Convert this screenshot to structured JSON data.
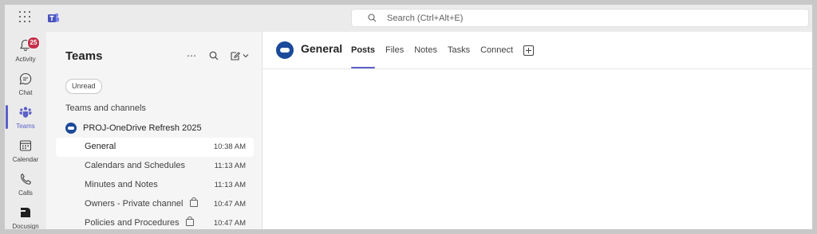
{
  "search": {
    "placeholder": "Search (Ctrl+Alt+E)"
  },
  "rail": {
    "items": [
      {
        "label": "Activity",
        "badge": "25",
        "icon": "bell-icon"
      },
      {
        "label": "Chat",
        "icon": "chat-icon"
      },
      {
        "label": "Teams",
        "icon": "teams-icon",
        "active": true
      },
      {
        "label": "Calendar",
        "icon": "calendar-icon"
      },
      {
        "label": "Calls",
        "icon": "phone-icon"
      },
      {
        "label": "Docusign",
        "icon": "docusign-icon"
      }
    ]
  },
  "panel": {
    "title": "Teams",
    "filter_chip": "Unread",
    "section_label": "Teams and channels",
    "team_name": "PROJ-OneDrive Refresh 2025",
    "channels": [
      {
        "name": "General",
        "time": "10:38 AM",
        "selected": true
      },
      {
        "name": "Calendars and Schedules",
        "time": "11:13 AM"
      },
      {
        "name": "Minutes and Notes",
        "time": "11:13 AM"
      },
      {
        "name": "Owners - Private channel",
        "time": "10:47 AM",
        "private": true
      },
      {
        "name": "Policies and Procedures",
        "time": "10:47 AM",
        "private": true
      }
    ]
  },
  "main": {
    "channel_title": "General",
    "tabs": [
      "Posts",
      "Files",
      "Notes",
      "Tasks",
      "Connect"
    ],
    "active_tab": "Posts"
  },
  "colors": {
    "accent": "#5b5fc7",
    "badge": "#c4314b",
    "team_logo": "#1b4a9a"
  }
}
